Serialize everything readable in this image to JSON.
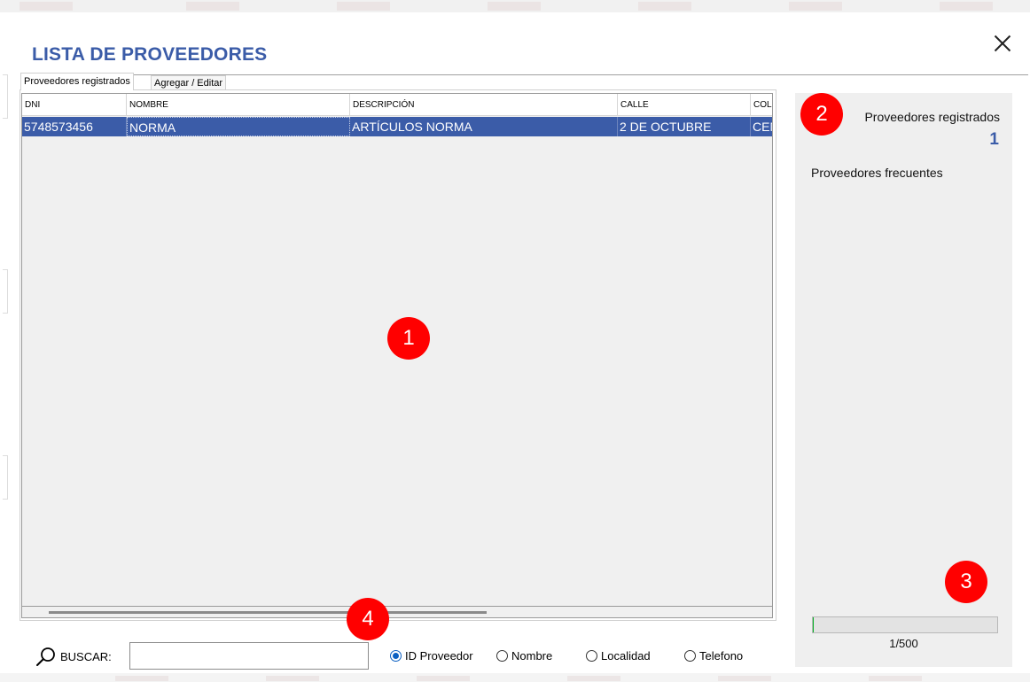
{
  "dialog": {
    "title": "LISTA DE PROVEEDORES",
    "close_icon": "close-icon"
  },
  "tabs": [
    {
      "label": "Proveedores registrados",
      "active": true
    },
    {
      "label": "Agregar / Editar",
      "active": false
    }
  ],
  "grid": {
    "columns": [
      "DNI",
      "NOMBRE",
      "DESCRIPCIÓN",
      "CALLE",
      "COL"
    ],
    "rows": [
      [
        "5748573456",
        "NORMA",
        "ARTÍCULOS NORMA",
        "2 DE OCTUBRE",
        "CEN"
      ]
    ],
    "selected_row_color": "#3b5ca8"
  },
  "side": {
    "registered_label": "Proveedores registrados",
    "registered_count": "1",
    "frequent_label": "Proveedores frecuentes",
    "progress_fraction": 0.002,
    "progress_text": "1/500"
  },
  "search": {
    "label": "BUSCAR:",
    "value": "",
    "placeholder": "",
    "icon": "search-icon",
    "options": [
      {
        "label": "ID Proveedor",
        "checked": true
      },
      {
        "label": "Nombre",
        "checked": false
      },
      {
        "label": "Localidad",
        "checked": false
      },
      {
        "label": "Telefono",
        "checked": false
      }
    ]
  },
  "callouts": [
    "1",
    "2",
    "3",
    "4"
  ],
  "colors": {
    "accent": "#3b5ca8",
    "callout": "#ff0000",
    "panel": "#efefef"
  }
}
